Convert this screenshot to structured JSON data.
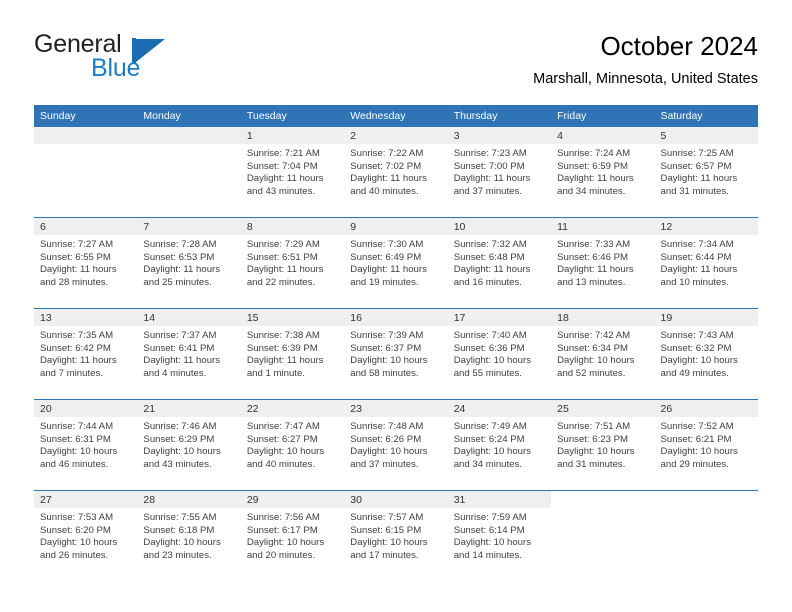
{
  "brand": {
    "name_top": "General",
    "name_bottom": "Blue",
    "accent_color": "#1c6cb3",
    "text_color": "#231f20"
  },
  "header": {
    "title": "October 2024",
    "location": "Marshall, Minnesota, United States"
  },
  "theme": {
    "header_row_bg": "#2f75b5",
    "header_row_text": "#ffffff",
    "daynum_band_bg": "#efefef",
    "row_divider": "#2f75b5",
    "cell_bg": "#ffffff",
    "body_text": "#404040"
  },
  "calendar": {
    "weekday_headers": [
      "Sunday",
      "Monday",
      "Tuesday",
      "Wednesday",
      "Thursday",
      "Friday",
      "Saturday"
    ],
    "weeks": [
      [
        {
          "day": "",
          "lines": []
        },
        {
          "day": "",
          "lines": []
        },
        {
          "day": "1",
          "lines": [
            "Sunrise: 7:21 AM",
            "Sunset: 7:04 PM",
            "Daylight: 11 hours",
            "and 43 minutes."
          ]
        },
        {
          "day": "2",
          "lines": [
            "Sunrise: 7:22 AM",
            "Sunset: 7:02 PM",
            "Daylight: 11 hours",
            "and 40 minutes."
          ]
        },
        {
          "day": "3",
          "lines": [
            "Sunrise: 7:23 AM",
            "Sunset: 7:00 PM",
            "Daylight: 11 hours",
            "and 37 minutes."
          ]
        },
        {
          "day": "4",
          "lines": [
            "Sunrise: 7:24 AM",
            "Sunset: 6:59 PM",
            "Daylight: 11 hours",
            "and 34 minutes."
          ]
        },
        {
          "day": "5",
          "lines": [
            "Sunrise: 7:25 AM",
            "Sunset: 6:57 PM",
            "Daylight: 11 hours",
            "and 31 minutes."
          ]
        }
      ],
      [
        {
          "day": "6",
          "lines": [
            "Sunrise: 7:27 AM",
            "Sunset: 6:55 PM",
            "Daylight: 11 hours",
            "and 28 minutes."
          ]
        },
        {
          "day": "7",
          "lines": [
            "Sunrise: 7:28 AM",
            "Sunset: 6:53 PM",
            "Daylight: 11 hours",
            "and 25 minutes."
          ]
        },
        {
          "day": "8",
          "lines": [
            "Sunrise: 7:29 AM",
            "Sunset: 6:51 PM",
            "Daylight: 11 hours",
            "and 22 minutes."
          ]
        },
        {
          "day": "9",
          "lines": [
            "Sunrise: 7:30 AM",
            "Sunset: 6:49 PM",
            "Daylight: 11 hours",
            "and 19 minutes."
          ]
        },
        {
          "day": "10",
          "lines": [
            "Sunrise: 7:32 AM",
            "Sunset: 6:48 PM",
            "Daylight: 11 hours",
            "and 16 minutes."
          ]
        },
        {
          "day": "11",
          "lines": [
            "Sunrise: 7:33 AM",
            "Sunset: 6:46 PM",
            "Daylight: 11 hours",
            "and 13 minutes."
          ]
        },
        {
          "day": "12",
          "lines": [
            "Sunrise: 7:34 AM",
            "Sunset: 6:44 PM",
            "Daylight: 11 hours",
            "and 10 minutes."
          ]
        }
      ],
      [
        {
          "day": "13",
          "lines": [
            "Sunrise: 7:35 AM",
            "Sunset: 6:42 PM",
            "Daylight: 11 hours",
            "and 7 minutes."
          ]
        },
        {
          "day": "14",
          "lines": [
            "Sunrise: 7:37 AM",
            "Sunset: 6:41 PM",
            "Daylight: 11 hours",
            "and 4 minutes."
          ]
        },
        {
          "day": "15",
          "lines": [
            "Sunrise: 7:38 AM",
            "Sunset: 6:39 PM",
            "Daylight: 11 hours",
            "and 1 minute."
          ]
        },
        {
          "day": "16",
          "lines": [
            "Sunrise: 7:39 AM",
            "Sunset: 6:37 PM",
            "Daylight: 10 hours",
            "and 58 minutes."
          ]
        },
        {
          "day": "17",
          "lines": [
            "Sunrise: 7:40 AM",
            "Sunset: 6:36 PM",
            "Daylight: 10 hours",
            "and 55 minutes."
          ]
        },
        {
          "day": "18",
          "lines": [
            "Sunrise: 7:42 AM",
            "Sunset: 6:34 PM",
            "Daylight: 10 hours",
            "and 52 minutes."
          ]
        },
        {
          "day": "19",
          "lines": [
            "Sunrise: 7:43 AM",
            "Sunset: 6:32 PM",
            "Daylight: 10 hours",
            "and 49 minutes."
          ]
        }
      ],
      [
        {
          "day": "20",
          "lines": [
            "Sunrise: 7:44 AM",
            "Sunset: 6:31 PM",
            "Daylight: 10 hours",
            "and 46 minutes."
          ]
        },
        {
          "day": "21",
          "lines": [
            "Sunrise: 7:46 AM",
            "Sunset: 6:29 PM",
            "Daylight: 10 hours",
            "and 43 minutes."
          ]
        },
        {
          "day": "22",
          "lines": [
            "Sunrise: 7:47 AM",
            "Sunset: 6:27 PM",
            "Daylight: 10 hours",
            "and 40 minutes."
          ]
        },
        {
          "day": "23",
          "lines": [
            "Sunrise: 7:48 AM",
            "Sunset: 6:26 PM",
            "Daylight: 10 hours",
            "and 37 minutes."
          ]
        },
        {
          "day": "24",
          "lines": [
            "Sunrise: 7:49 AM",
            "Sunset: 6:24 PM",
            "Daylight: 10 hours",
            "and 34 minutes."
          ]
        },
        {
          "day": "25",
          "lines": [
            "Sunrise: 7:51 AM",
            "Sunset: 6:23 PM",
            "Daylight: 10 hours",
            "and 31 minutes."
          ]
        },
        {
          "day": "26",
          "lines": [
            "Sunrise: 7:52 AM",
            "Sunset: 6:21 PM",
            "Daylight: 10 hours",
            "and 29 minutes."
          ]
        }
      ],
      [
        {
          "day": "27",
          "lines": [
            "Sunrise: 7:53 AM",
            "Sunset: 6:20 PM",
            "Daylight: 10 hours",
            "and 26 minutes."
          ]
        },
        {
          "day": "28",
          "lines": [
            "Sunrise: 7:55 AM",
            "Sunset: 6:18 PM",
            "Daylight: 10 hours",
            "and 23 minutes."
          ]
        },
        {
          "day": "29",
          "lines": [
            "Sunrise: 7:56 AM",
            "Sunset: 6:17 PM",
            "Daylight: 10 hours",
            "and 20 minutes."
          ]
        },
        {
          "day": "30",
          "lines": [
            "Sunrise: 7:57 AM",
            "Sunset: 6:15 PM",
            "Daylight: 10 hours",
            "and 17 minutes."
          ]
        },
        {
          "day": "31",
          "lines": [
            "Sunrise: 7:59 AM",
            "Sunset: 6:14 PM",
            "Daylight: 10 hours",
            "and 14 minutes."
          ]
        },
        {
          "day": "",
          "lines": []
        },
        {
          "day": "",
          "lines": []
        }
      ]
    ]
  }
}
